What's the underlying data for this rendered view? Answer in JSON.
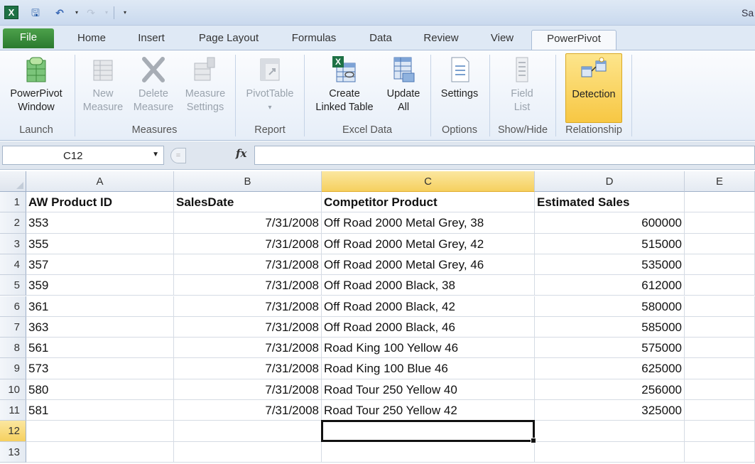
{
  "window": {
    "title": "Sa"
  },
  "tabs": [
    {
      "label": "File"
    },
    {
      "label": "Home"
    },
    {
      "label": "Insert"
    },
    {
      "label": "Page Layout"
    },
    {
      "label": "Formulas"
    },
    {
      "label": "Data"
    },
    {
      "label": "Review"
    },
    {
      "label": "View"
    },
    {
      "label": "PowerPivot"
    }
  ],
  "ribbon": {
    "buttons": [
      {
        "line1": "PowerPivot",
        "line2": "Window",
        "icon": "powerpivot-window-icon",
        "enabled": true
      },
      {
        "line1": "New",
        "line2": "Measure",
        "icon": "new-measure-icon",
        "enabled": false
      },
      {
        "line1": "Delete",
        "line2": "Measure",
        "icon": "delete-measure-icon",
        "enabled": false
      },
      {
        "line1": "Measure",
        "line2": "Settings",
        "icon": "measure-settings-icon",
        "enabled": false
      },
      {
        "line1": "PivotTable",
        "line2": "▾",
        "icon": "pivottable-icon",
        "enabled": false
      },
      {
        "line1": "Create",
        "line2": "Linked Table",
        "icon": "create-linked-table-icon",
        "enabled": true
      },
      {
        "line1": "Update",
        "line2": "All",
        "icon": "update-all-icon",
        "enabled": true
      },
      {
        "line1": "Settings",
        "line2": "",
        "icon": "settings-icon",
        "enabled": true
      },
      {
        "line1": "Field",
        "line2": "List",
        "icon": "field-list-icon",
        "enabled": false
      },
      {
        "line1": "Detection",
        "line2": "",
        "icon": "detection-icon",
        "enabled": true,
        "active": true
      }
    ],
    "groups": [
      {
        "label": "Launch"
      },
      {
        "label": "Measures"
      },
      {
        "label": "Report"
      },
      {
        "label": "Excel Data"
      },
      {
        "label": "Options"
      },
      {
        "label": "Show/Hide"
      },
      {
        "label": "Relationship"
      }
    ]
  },
  "formula_bar": {
    "name_box": "C12",
    "fx_label": "fx",
    "formula": ""
  },
  "sheet": {
    "columns": [
      "A",
      "B",
      "C",
      "D",
      "E"
    ],
    "selected_column": "C",
    "selected_row": 12,
    "rows": [
      {
        "num": "1",
        "cells": [
          "AW Product ID",
          "SalesDate",
          "Competitor Product",
          "Estimated Sales",
          ""
        ]
      },
      {
        "num": "2",
        "cells": [
          "353",
          "7/31/2008",
          "Off Road 2000 Metal Grey, 38",
          "600000",
          ""
        ]
      },
      {
        "num": "3",
        "cells": [
          "355",
          "7/31/2008",
          "Off Road 2000 Metal Grey, 42",
          "515000",
          ""
        ]
      },
      {
        "num": "4",
        "cells": [
          "357",
          "7/31/2008",
          "Off Road 2000 Metal Grey, 46",
          "535000",
          ""
        ]
      },
      {
        "num": "5",
        "cells": [
          "359",
          "7/31/2008",
          "Off Road 2000 Black, 38",
          "612000",
          ""
        ]
      },
      {
        "num": "6",
        "cells": [
          "361",
          "7/31/2008",
          "Off Road 2000 Black, 42",
          "580000",
          ""
        ]
      },
      {
        "num": "7",
        "cells": [
          "363",
          "7/31/2008",
          "Off Road 2000 Black, 46",
          "585000",
          ""
        ]
      },
      {
        "num": "8",
        "cells": [
          "561",
          "7/31/2008",
          "Road King 100 Yellow 46",
          "575000",
          ""
        ]
      },
      {
        "num": "9",
        "cells": [
          "573",
          "7/31/2008",
          "Road King 100 Blue 46",
          "625000",
          ""
        ]
      },
      {
        "num": "10",
        "cells": [
          "580",
          "7/31/2008",
          "Road Tour 250 Yellow 40",
          "256000",
          ""
        ]
      },
      {
        "num": "11",
        "cells": [
          "581",
          "7/31/2008",
          "Road Tour 250 Yellow 42",
          "325000",
          ""
        ]
      },
      {
        "num": "12",
        "cells": [
          "",
          "",
          "",
          "",
          ""
        ]
      },
      {
        "num": "13",
        "cells": [
          "",
          "",
          "",
          "",
          ""
        ]
      }
    ]
  }
}
